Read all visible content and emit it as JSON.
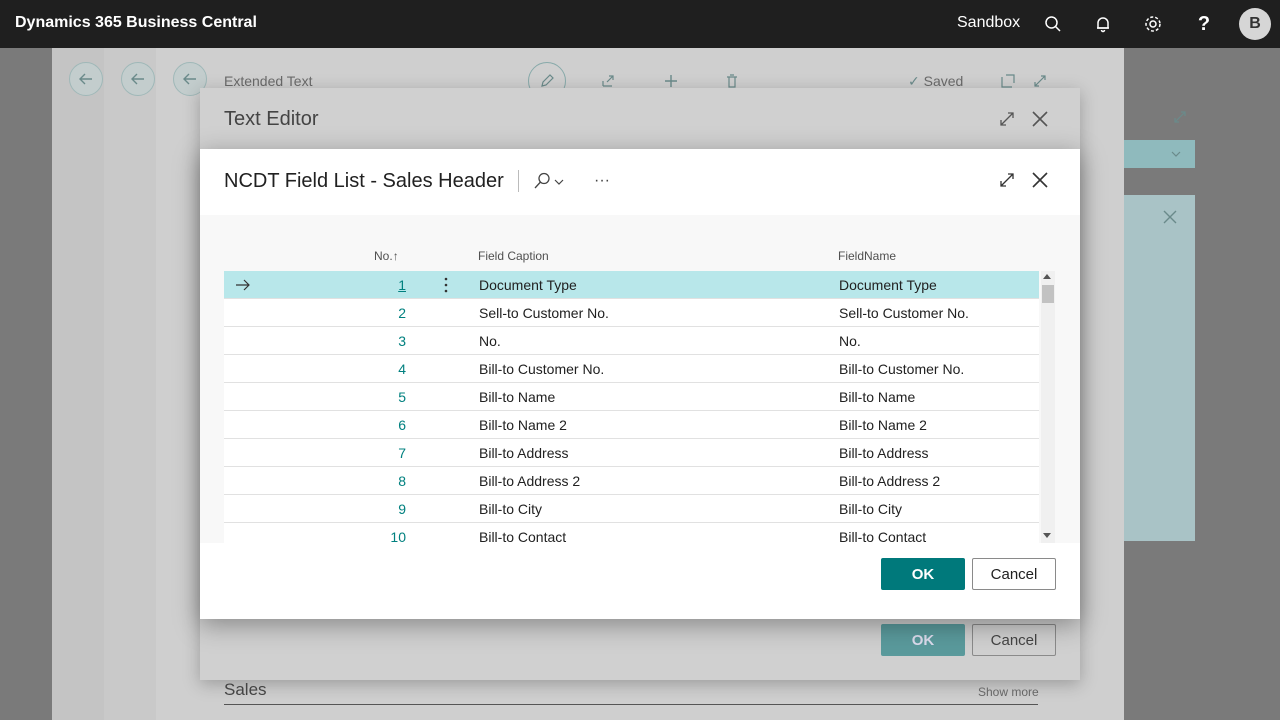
{
  "appbar": {
    "brand": "Dynamics 365 Business Central",
    "environment": "Sandbox",
    "avatar_initial": "B",
    "icons": [
      "search-icon",
      "bell-icon",
      "gear-icon",
      "help-icon"
    ]
  },
  "background_page": {
    "title": "Extended Text",
    "saved_label": "Saved"
  },
  "text_editor": {
    "title": "Text Editor",
    "ok_label": "OK",
    "cancel_label": "Cancel",
    "section_title": "Sales",
    "show_more": "Show more"
  },
  "modal": {
    "title": "NCDT Field List - Sales Header",
    "more_label": "···",
    "columns": {
      "no": "No.",
      "sort_indicator": "↑",
      "caption": "Field Caption",
      "fieldname": "FieldName"
    },
    "rows": [
      {
        "no": "1",
        "caption": "Document Type",
        "fieldname": "Document Type",
        "selected": true
      },
      {
        "no": "2",
        "caption": "Sell-to Customer No.",
        "fieldname": "Sell-to Customer No."
      },
      {
        "no": "3",
        "caption": "No.",
        "fieldname": "No."
      },
      {
        "no": "4",
        "caption": "Bill-to Customer No.",
        "fieldname": "Bill-to Customer No."
      },
      {
        "no": "5",
        "caption": "Bill-to Name",
        "fieldname": "Bill-to Name"
      },
      {
        "no": "6",
        "caption": "Bill-to Name 2",
        "fieldname": "Bill-to Name 2"
      },
      {
        "no": "7",
        "caption": "Bill-to Address",
        "fieldname": "Bill-to Address"
      },
      {
        "no": "8",
        "caption": "Bill-to Address 2",
        "fieldname": "Bill-to Address 2"
      },
      {
        "no": "9",
        "caption": "Bill-to City",
        "fieldname": "Bill-to City"
      },
      {
        "no": "10",
        "caption": "Bill-to Contact",
        "fieldname": "Bill-to Contact"
      }
    ],
    "ok_label": "OK",
    "cancel_label": "Cancel"
  },
  "colors": {
    "appbar": "#1f1f1f",
    "accent": "#00797b",
    "link": "#00807f",
    "selected_row": "#b8e7ea"
  }
}
